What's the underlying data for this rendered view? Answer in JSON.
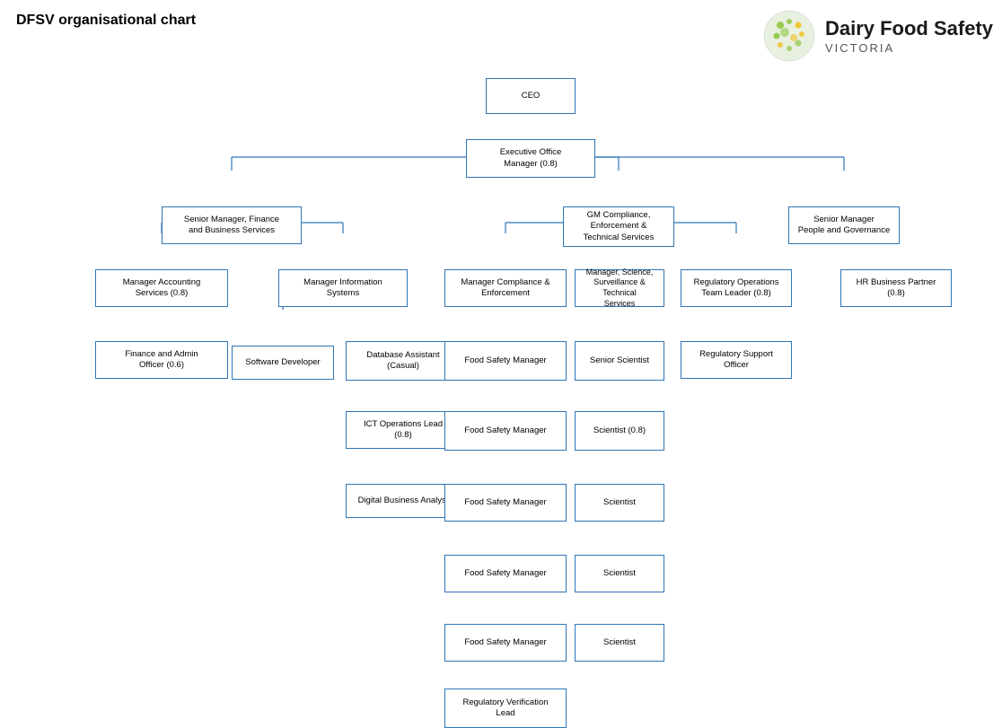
{
  "title": "DFSV organisational chart",
  "logo": {
    "name": "Dairy Food Safety VICTORIA",
    "line1": "Dairy Food Safety",
    "line2": "VICTORIA"
  },
  "nodes": {
    "ceo": {
      "label": "CEO"
    },
    "exec_office": {
      "label": "Executive Office\nManager (0.8)"
    },
    "sm_finance": {
      "label": "Senior Manager, Finance\nand Business Services"
    },
    "gm_compliance": {
      "label": "GM Compliance,\nEnforcement &\nTechnical Services"
    },
    "sm_people": {
      "label": "Senior Manager\nPeople and Governance"
    },
    "mgr_accounting": {
      "label": "Manager Accounting\nServices (0.8)"
    },
    "mgr_info": {
      "label": "Manager Information\nSystems"
    },
    "mgr_compliance": {
      "label": "Manager Compliance &\nEnforcement"
    },
    "mgr_science": {
      "label": "Manager, Science,\nSurveillance & Technical\nServices"
    },
    "reg_ops": {
      "label": "Regulatory Operations\nTeam Leader  (0.8)"
    },
    "hr_partner": {
      "label": "HR Business Partner\n(0.8)"
    },
    "finance_admin": {
      "label": "Finance and Admin\nOfficer (0.6)"
    },
    "sw_dev": {
      "label": "Software Developer"
    },
    "db_assistant": {
      "label": "Database Assistant\n(Casual)"
    },
    "ict_ops": {
      "label": "ICT Operations Lead\n(0.8)"
    },
    "digital_analyst": {
      "label": "Digital Business Analyst"
    },
    "fsm1": {
      "label": "Food Safety Manager"
    },
    "fsm2": {
      "label": "Food Safety Manager"
    },
    "fsm3": {
      "label": "Food Safety Manager"
    },
    "fsm4": {
      "label": "Food Safety Manager"
    },
    "fsm5": {
      "label": "Food Safety Manager"
    },
    "reg_verif": {
      "label": "Regulatory Verification\nLead"
    },
    "senior_scientist": {
      "label": "Senior Scientist"
    },
    "scientist_08": {
      "label": "Scientist (0.8)"
    },
    "scientist1": {
      "label": "Scientist"
    },
    "scientist2": {
      "label": "Scientist"
    },
    "scientist3": {
      "label": "Scientist"
    },
    "reg_support": {
      "label": "Regulatory Support\nOfficer"
    }
  }
}
